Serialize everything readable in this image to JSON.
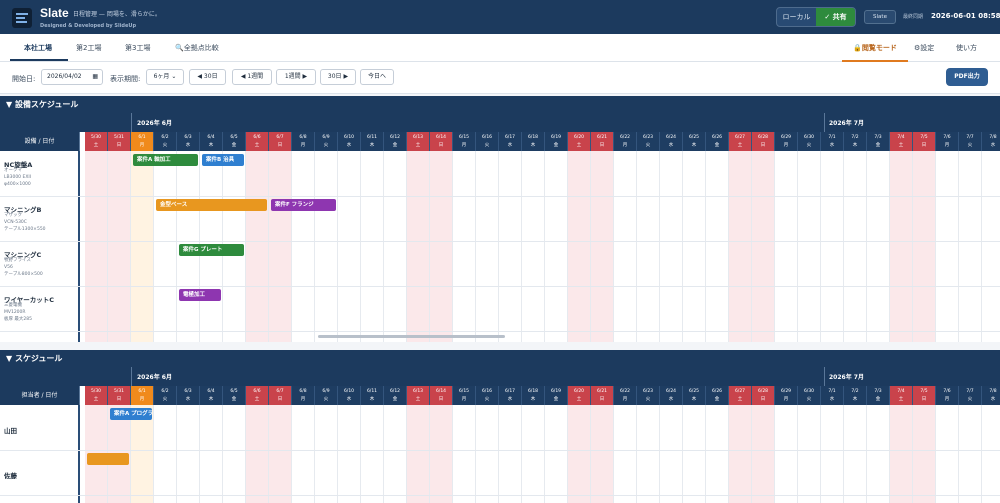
{
  "header": {
    "app_name": "Slate",
    "tagline": "日程管理 — 岡場を、滑らかに。",
    "credit": "Designed & Developed by SlideUp",
    "mode_local": "ローカル",
    "mode_shared": "✓ 共有",
    "slate_button": "Slate",
    "last_sync_label": "最終同期",
    "last_sync_value": "2026-06-01 08:58"
  },
  "tabs": [
    {
      "label": "本社工場"
    },
    {
      "label": "第2工場"
    },
    {
      "label": "第3工場"
    },
    {
      "label": "全拠点比較"
    }
  ],
  "tab_icons": {
    "compare": "search-icon",
    "view": "lock-icon",
    "settings": "gear-icon"
  },
  "right_tabs": {
    "view_mode": "閲覧モード",
    "settings": "設定",
    "howto": "使い方"
  },
  "toolbar": {
    "start_label": "開始日:",
    "start_value": "2026/04/02",
    "period_label": "表示期間:",
    "period_value": "6ヶ月",
    "back30": "◀ 30日",
    "back1w": "◀ 1週間",
    "fwd1w": "1週間 ▶",
    "fwd30": "30日 ▶",
    "today": "今日へ",
    "pdf": "PDF出力"
  },
  "calendar": {
    "month_june": "2026年 6月",
    "month_july": "2026年 7月",
    "days": [
      {
        "d": "5/30",
        "w": "土",
        "t": "we"
      },
      {
        "d": "5/31",
        "w": "日",
        "t": "we"
      },
      {
        "d": "6/1",
        "w": "月",
        "t": "today"
      },
      {
        "d": "6/2",
        "w": "火",
        "t": ""
      },
      {
        "d": "6/3",
        "w": "水",
        "t": ""
      },
      {
        "d": "6/4",
        "w": "木",
        "t": ""
      },
      {
        "d": "6/5",
        "w": "金",
        "t": ""
      },
      {
        "d": "6/6",
        "w": "土",
        "t": "we"
      },
      {
        "d": "6/7",
        "w": "日",
        "t": "we"
      },
      {
        "d": "6/8",
        "w": "月",
        "t": ""
      },
      {
        "d": "6/9",
        "w": "火",
        "t": ""
      },
      {
        "d": "6/10",
        "w": "水",
        "t": ""
      },
      {
        "d": "6/11",
        "w": "木",
        "t": ""
      },
      {
        "d": "6/12",
        "w": "金",
        "t": ""
      },
      {
        "d": "6/13",
        "w": "土",
        "t": "we"
      },
      {
        "d": "6/14",
        "w": "日",
        "t": "we"
      },
      {
        "d": "6/15",
        "w": "月",
        "t": ""
      },
      {
        "d": "6/16",
        "w": "火",
        "t": ""
      },
      {
        "d": "6/17",
        "w": "水",
        "t": ""
      },
      {
        "d": "6/18",
        "w": "木",
        "t": ""
      },
      {
        "d": "6/19",
        "w": "金",
        "t": ""
      },
      {
        "d": "6/20",
        "w": "土",
        "t": "we"
      },
      {
        "d": "6/21",
        "w": "日",
        "t": "we"
      },
      {
        "d": "6/22",
        "w": "月",
        "t": ""
      },
      {
        "d": "6/23",
        "w": "火",
        "t": ""
      },
      {
        "d": "6/24",
        "w": "水",
        "t": ""
      },
      {
        "d": "6/25",
        "w": "木",
        "t": ""
      },
      {
        "d": "6/26",
        "w": "金",
        "t": ""
      },
      {
        "d": "6/27",
        "w": "土",
        "t": "we"
      },
      {
        "d": "6/28",
        "w": "日",
        "t": "we"
      },
      {
        "d": "6/29",
        "w": "月",
        "t": ""
      },
      {
        "d": "6/30",
        "w": "火",
        "t": ""
      },
      {
        "d": "7/1",
        "w": "水",
        "t": ""
      },
      {
        "d": "7/2",
        "w": "木",
        "t": ""
      },
      {
        "d": "7/3",
        "w": "金",
        "t": ""
      },
      {
        "d": "7/4",
        "w": "土",
        "t": "we"
      },
      {
        "d": "7/5",
        "w": "日",
        "t": "we"
      },
      {
        "d": "7/6",
        "w": "月",
        "t": ""
      },
      {
        "d": "7/7",
        "w": "火",
        "t": ""
      },
      {
        "d": "7/8",
        "w": "水",
        "t": ""
      }
    ]
  },
  "equipment": {
    "title": "▼ 設備スケジュール",
    "corner": "設備 / 日付",
    "rows": [
      {
        "name": "NC旋盤A",
        "sub": [
          "オークマ",
          "LB3000 EXII",
          "φ400×1000"
        ],
        "bars": [
          {
            "label": "案件A 軸加工",
            "start": 2,
            "days": 3,
            "color": "#2e8b3d"
          },
          {
            "label": "案件B 治具",
            "start": 5,
            "days": 2,
            "color": "#2f7fd0"
          }
        ]
      },
      {
        "name": "マシニングB",
        "sub": [
          "マザック",
          "VCN-530C",
          "テーブル1300×550"
        ],
        "bars": [
          {
            "label": "金型ベース",
            "start": 3,
            "days": 5,
            "color": "#e8971f"
          },
          {
            "label": "案件F フランジ",
            "start": 8,
            "days": 3,
            "color": "#8e36b0"
          }
        ]
      },
      {
        "name": "マシニングC",
        "sub": [
          "牧野フライス",
          "V56",
          "テーブル800×500"
        ],
        "bars": [
          {
            "label": "案件G プレート",
            "start": 4,
            "days": 3,
            "color": "#2e8b3d"
          }
        ]
      },
      {
        "name": "ワイヤーカットC",
        "sub": [
          "三菱電機",
          "MV1200R",
          "板厚 最大285"
        ],
        "bars": [
          {
            "label": "電極加工",
            "start": 4,
            "days": 2,
            "color": "#8e36b0"
          }
        ]
      }
    ]
  },
  "staff": {
    "title": "▼ スケジュール",
    "corner": "担当者 / 日付",
    "rows": [
      {
        "name": "山田",
        "bars": [
          {
            "label": "案件A プログラム",
            "start": 1,
            "days": 2,
            "color": "#2f7fd0"
          }
        ]
      },
      {
        "name": "佐藤",
        "bars": [
          {
            "label": "",
            "start": 0,
            "days": 2,
            "color": "#e8971f"
          }
        ]
      }
    ]
  }
}
